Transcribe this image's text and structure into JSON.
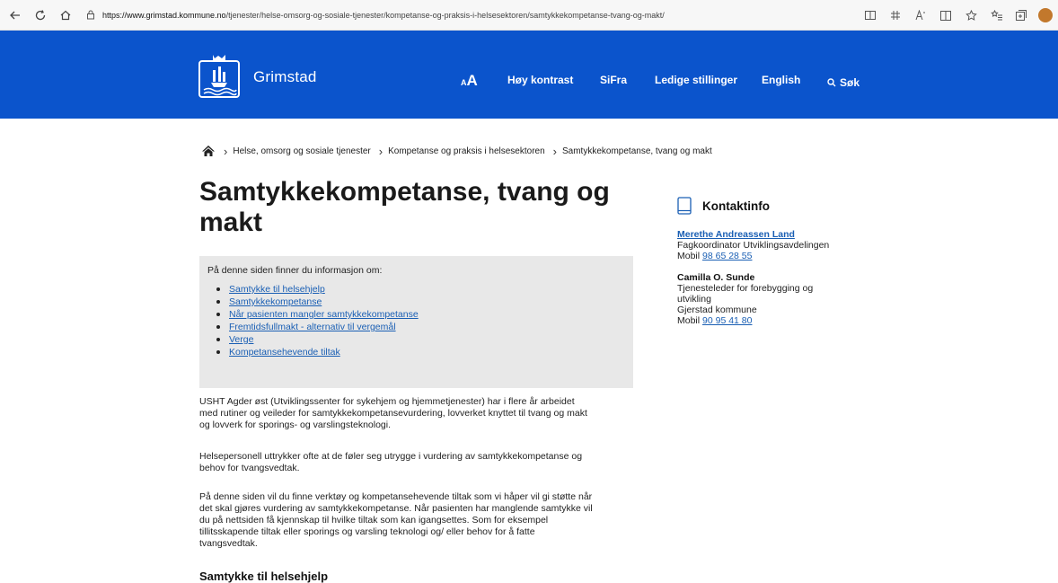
{
  "browser": {
    "url_host": "https://www.grimstad.kommune.no",
    "url_path": "/tjenester/helse-omsorg-og-sosiale-tjenester/kompetanse-og-praksis-i-helsesektoren/samtykkekompetanse-tvang-og-makt/"
  },
  "header": {
    "logo_text": "Grimstad",
    "font_size_small": "A",
    "font_size_big": "A",
    "nav": [
      "Høy kontrast",
      "SiFra",
      "Ledige stillinger",
      "English"
    ],
    "search_label": "Søk"
  },
  "breadcrumb": [
    "Helse, omsorg og sosiale tjenester",
    "Kompetanse og praksis i helsesektoren",
    "Samtykkekompetanse, tvang og makt"
  ],
  "main": {
    "title_line1": "Samtykkekompetanse, tvang og",
    "title_line2": "makt",
    "info_intro": "På denne siden finner du informasjon om:",
    "toc": [
      "Samtykke til helsehjelp",
      "Samtykkekompetanse",
      "Når pasienten mangler samtykkekompetanse",
      "Fremtidsfullmakt - alternativ til vergemål",
      "Verge",
      "Kompetansehevende tiltak"
    ],
    "para1_l1": "USHT Agder øst (Utviklingssenter for sykehjem og hjemmetjenester) har i flere år arbeidet",
    "para1_l2": "med rutiner og  veileder for samtykkekompetansevurdering, lovverket knyttet til tvang og makt",
    "para1_l3": "og  lovverk for  sporings- og varslingsteknologi.",
    "para2_l1": "Helsepersonell uttrykker ofte at de føler seg utrygge i vurdering av samtykkekompetanse og",
    "para2_l2": "behov for tvangsvedtak.",
    "para3_l1": "På denne siden vil du finne verktøy og kompetansehevende tiltak som vi håper vil gi støtte når",
    "para3_l2": "det skal gjøres vurdering av samtykkekompetanse. Når pasienten har manglende samtykke vil",
    "para3_l3": "du på nettsiden få  kjennskap til hvilke tiltak som kan igangsettes. Som for eksempel",
    "para3_l4": "tillitsskapende tiltak eller sporings og varsling teknologi og/ eller behov for å fatte",
    "para3_l5": "tvangsvedtak.",
    "section_heading": "Samtykke til helsehjelp"
  },
  "contact": {
    "title": "Kontaktinfo",
    "person1": {
      "name": "Merethe Andreassen Land",
      "role": "Fagkoordinator Utviklingsavdelingen",
      "phone_label": "Mobil",
      "phone": "98 65 28 55"
    },
    "person2": {
      "name": "Camilla O. Sunde",
      "role_l1": "Tjenesteleder for forebygging og",
      "role_l2": "utvikling",
      "org": "Gjerstad kommune",
      "phone_label": "Mobil",
      "phone": "90 95 41 80"
    }
  },
  "colors": {
    "header_bg": "#0b54cc",
    "link": "#1a5fb4",
    "info_box_bg": "#e8e8e8"
  }
}
